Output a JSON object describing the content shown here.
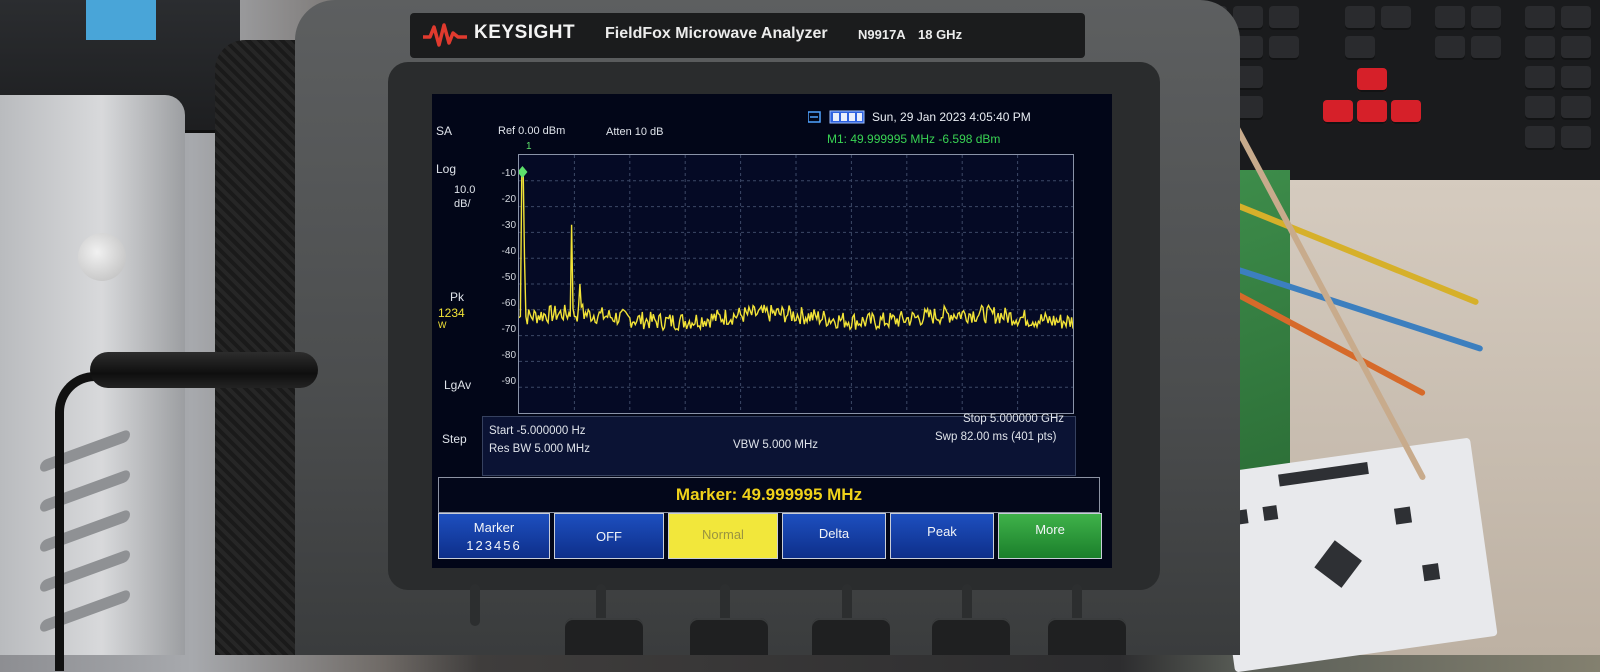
{
  "device": {
    "brand": "KEYSIGHT",
    "product": "FieldFox Microwave Analyzer",
    "model": "N9917A",
    "max_freq": "18 GHz"
  },
  "screen": {
    "mode": "SA",
    "ref_level": "Ref 0.00 dBm",
    "atten": "Atten 10 dB",
    "datetime": "Sun, 29 Jan 2023 4:05:40 PM",
    "marker_readout": "M1:  49.999995 MHz  -6.598 dBm",
    "marker_number": "1",
    "side_labels": {
      "scale_type": "Log",
      "scale_value": "10.0",
      "scale_unit": "dB/",
      "detector": "Pk",
      "detector_digits": "1234",
      "detector_trace": "W",
      "averaging": "LgAv",
      "step": "Step"
    },
    "y_ticks": [
      "-10",
      "-20",
      "-30",
      "-40",
      "-50",
      "-60",
      "-70",
      "-80",
      "-90"
    ],
    "info": {
      "start": "Start -5.000000  Hz",
      "res_bw": "Res BW 5.000 MHz",
      "vbw": "VBW 5.000 MHz",
      "stop": "Stop 5.000000 GHz",
      "sweep": "Swp 82.00 ms (401 pts)"
    },
    "marker_banner": "Marker:  49.999995 MHz",
    "softkeys": [
      {
        "label": "Marker",
        "sub": "123456"
      },
      {
        "label": "OFF"
      },
      {
        "label": "Normal"
      },
      {
        "label": "Delta"
      },
      {
        "label": "Peak"
      },
      {
        "label": "More"
      }
    ]
  },
  "colors": {
    "trace": "#f2e337",
    "marker_readout": "#39d353",
    "softkey_blue": "#1d4fbf",
    "softkey_selected": "#f2e73b",
    "softkey_more": "#2e9a3b"
  }
}
